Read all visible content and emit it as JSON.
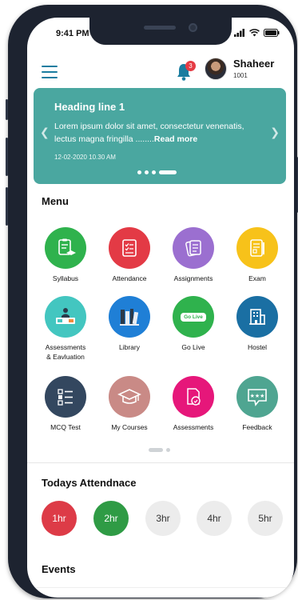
{
  "status": {
    "time": "9:41 PM"
  },
  "header": {
    "notification_count": "3",
    "user_name": "Shaheer",
    "user_id": "1001"
  },
  "banner": {
    "title": "Heading line 1",
    "text": "Lorem ipsum dolor sit amet, consectetur venenatis, lectus magna fringilla ........",
    "read_more": "Read more",
    "date": "12-02-2020  10.30 AM"
  },
  "menu": {
    "title": "Menu",
    "items": [
      {
        "label": "Syllabus",
        "color": "#2fb24d",
        "icon": "syllabus-icon"
      },
      {
        "label": "Attendance",
        "color": "#e33a45",
        "icon": "attendance-icon"
      },
      {
        "label": "Assignments",
        "color": "#9b6fd0",
        "icon": "assignments-icon"
      },
      {
        "label": "Exam",
        "color": "#f7c21a",
        "icon": "exam-icon"
      },
      {
        "label": "Assessments\n& Eavluation",
        "color": "#43c6c0",
        "icon": "assessments-evaluation-icon"
      },
      {
        "label": "Library",
        "color": "#1f7fd6",
        "icon": "library-icon"
      },
      {
        "label": "Go Live",
        "color": "#2fb24d",
        "icon": "go-live-icon",
        "badge": "Go Live"
      },
      {
        "label": "Hostel",
        "color": "#1a6fa3",
        "icon": "hostel-icon"
      },
      {
        "label": "MCQ Test",
        "color": "#33475f",
        "icon": "mcq-test-icon"
      },
      {
        "label": "My Courses",
        "color": "#c98a86",
        "icon": "my-courses-icon"
      },
      {
        "label": "Assessments",
        "color": "#e6177a",
        "icon": "assessments-icon"
      },
      {
        "label": "Feedback",
        "color": "#4fa591",
        "icon": "feedback-icon"
      }
    ]
  },
  "attendance": {
    "title": "Todays Attendnace",
    "hours": [
      {
        "label": "1hr",
        "state": "red"
      },
      {
        "label": "2hr",
        "state": "green"
      },
      {
        "label": "3hr",
        "state": "none"
      },
      {
        "label": "4hr",
        "state": "none"
      },
      {
        "label": "5hr",
        "state": "none"
      }
    ]
  },
  "events": {
    "title": "Events"
  }
}
